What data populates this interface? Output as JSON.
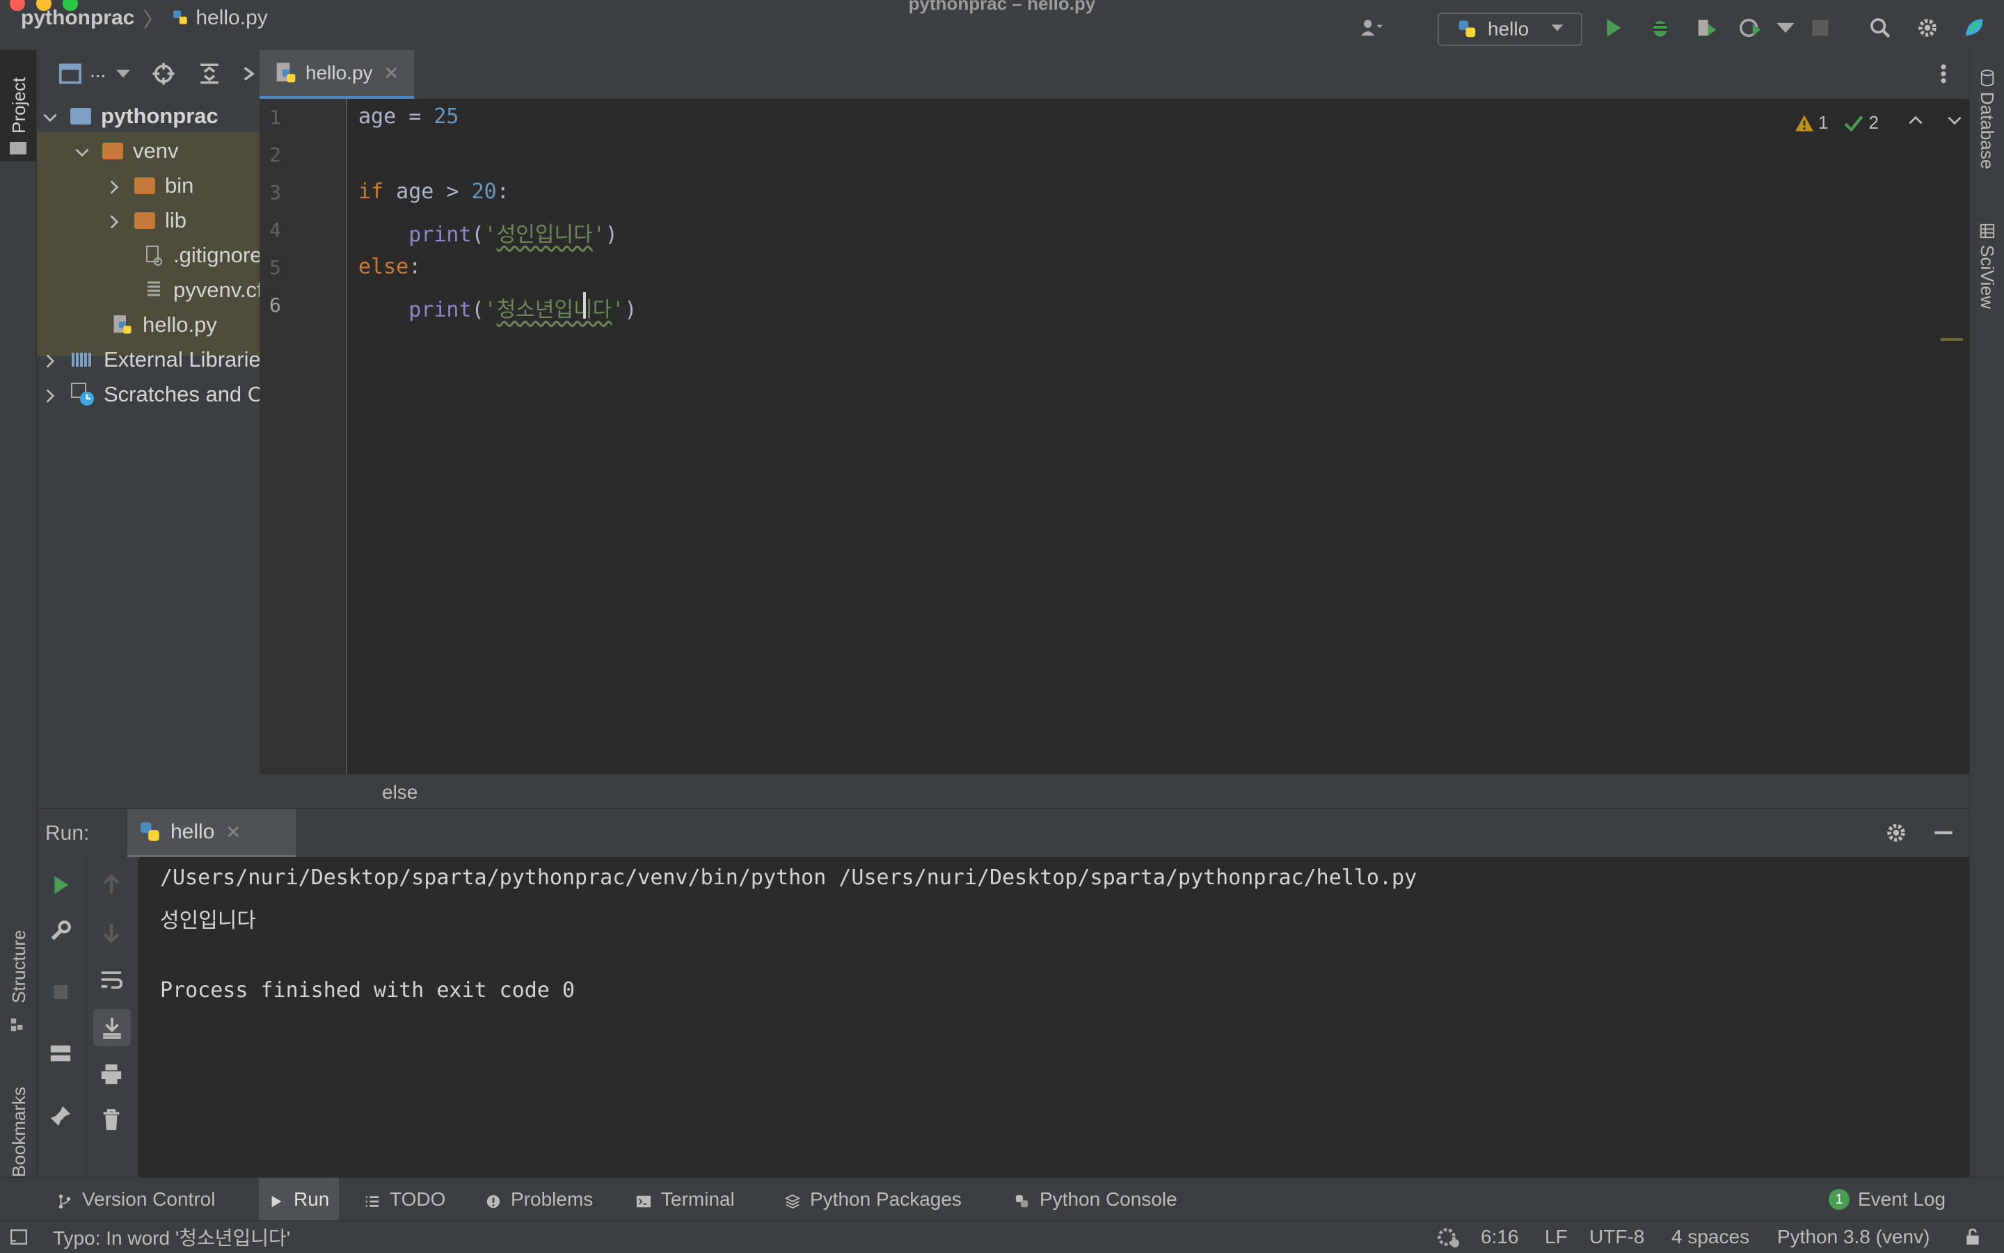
{
  "window": {
    "title": "pythonprac – hello.py"
  },
  "navbar": {
    "project_crumb": "pythonprac",
    "file_crumb": "hello.py",
    "run_config": "hello"
  },
  "left_stripe": {
    "project_tab": "Project",
    "structure_tab": "Structure",
    "bookmarks_tab": "Bookmarks"
  },
  "right_stripe": {
    "database_tab": "Database",
    "sciview_tab": "SciView"
  },
  "project_tree": {
    "toolbar_label": "...",
    "items": [
      {
        "label": "pythonprac",
        "level": 0
      },
      {
        "label": "venv",
        "level": 1
      },
      {
        "label": "bin",
        "level": 2
      },
      {
        "label": "lib",
        "level": 2
      },
      {
        "label": ".gitignore",
        "level": 2
      },
      {
        "label": "pyvenv.cfg",
        "level": 2
      },
      {
        "label": "hello.py",
        "level": 1
      },
      {
        "label": "External Libraries",
        "level": 0
      },
      {
        "label": "Scratches and Consoles",
        "level": 0
      }
    ]
  },
  "editor": {
    "tab_label": "hello.py",
    "warnings_count": "1",
    "checks_count": "2",
    "lines": [
      "1",
      "2",
      "3",
      "4",
      "5",
      "6"
    ],
    "code": {
      "l1_var": "age",
      "l1_op": " = ",
      "l1_num": "25",
      "l3_kw": "if",
      "l3_mid": " age > ",
      "l3_num": "20",
      "l3_end": ":",
      "l4_indent": "    ",
      "l4_fn": "print",
      "l4_open": "(",
      "l4_q1": "'",
      "l4_str": "성인입니다",
      "l4_q2": "'",
      "l4_close": ")",
      "l5_kw": "else",
      "l5_end": ":",
      "l6_indent": "    ",
      "l6_fn": "print",
      "l6_open": "(",
      "l6_q1": "'",
      "l6_str": "청소년입니다",
      "l6_q2": "'",
      "l6_close": ")"
    },
    "breadcrumb": "else"
  },
  "run_panel": {
    "label": "Run:",
    "tab_label": "hello",
    "output": [
      "/Users/nuri/Desktop/sparta/pythonprac/venv/bin/python /Users/nuri/Desktop/sparta/pythonprac/hello.py",
      "성인입니다",
      "",
      "Process finished with exit code 0"
    ]
  },
  "tool_windows": [
    {
      "label": "Version Control",
      "icon": "branch-icon"
    },
    {
      "label": "Run",
      "icon": "play-icon"
    },
    {
      "label": "TODO",
      "icon": "list-icon"
    },
    {
      "label": "Problems",
      "icon": "alert-circle-icon"
    },
    {
      "label": "Terminal",
      "icon": "terminal-icon"
    },
    {
      "label": "Python Packages",
      "icon": "layers-icon"
    },
    {
      "label": "Python Console",
      "icon": "python-icon"
    }
  ],
  "event_log": {
    "label": "Event Log",
    "count": "1"
  },
  "status_bar": {
    "message": "Typo: In word '청소년입니다'",
    "position": "6:16",
    "line_sep": "LF",
    "encoding": "UTF-8",
    "indent": "4 spaces",
    "interpreter": "Python 3.8 (venv)"
  },
  "colors": {
    "panel_bg": "#3c3f41",
    "editor_bg": "#2b2b2b",
    "keyword": "#cc7832",
    "number": "#6897bb",
    "string": "#6a8759",
    "builtin": "#8888c6",
    "accent_tab": "#4a88c7",
    "run_green": "#499c54"
  }
}
